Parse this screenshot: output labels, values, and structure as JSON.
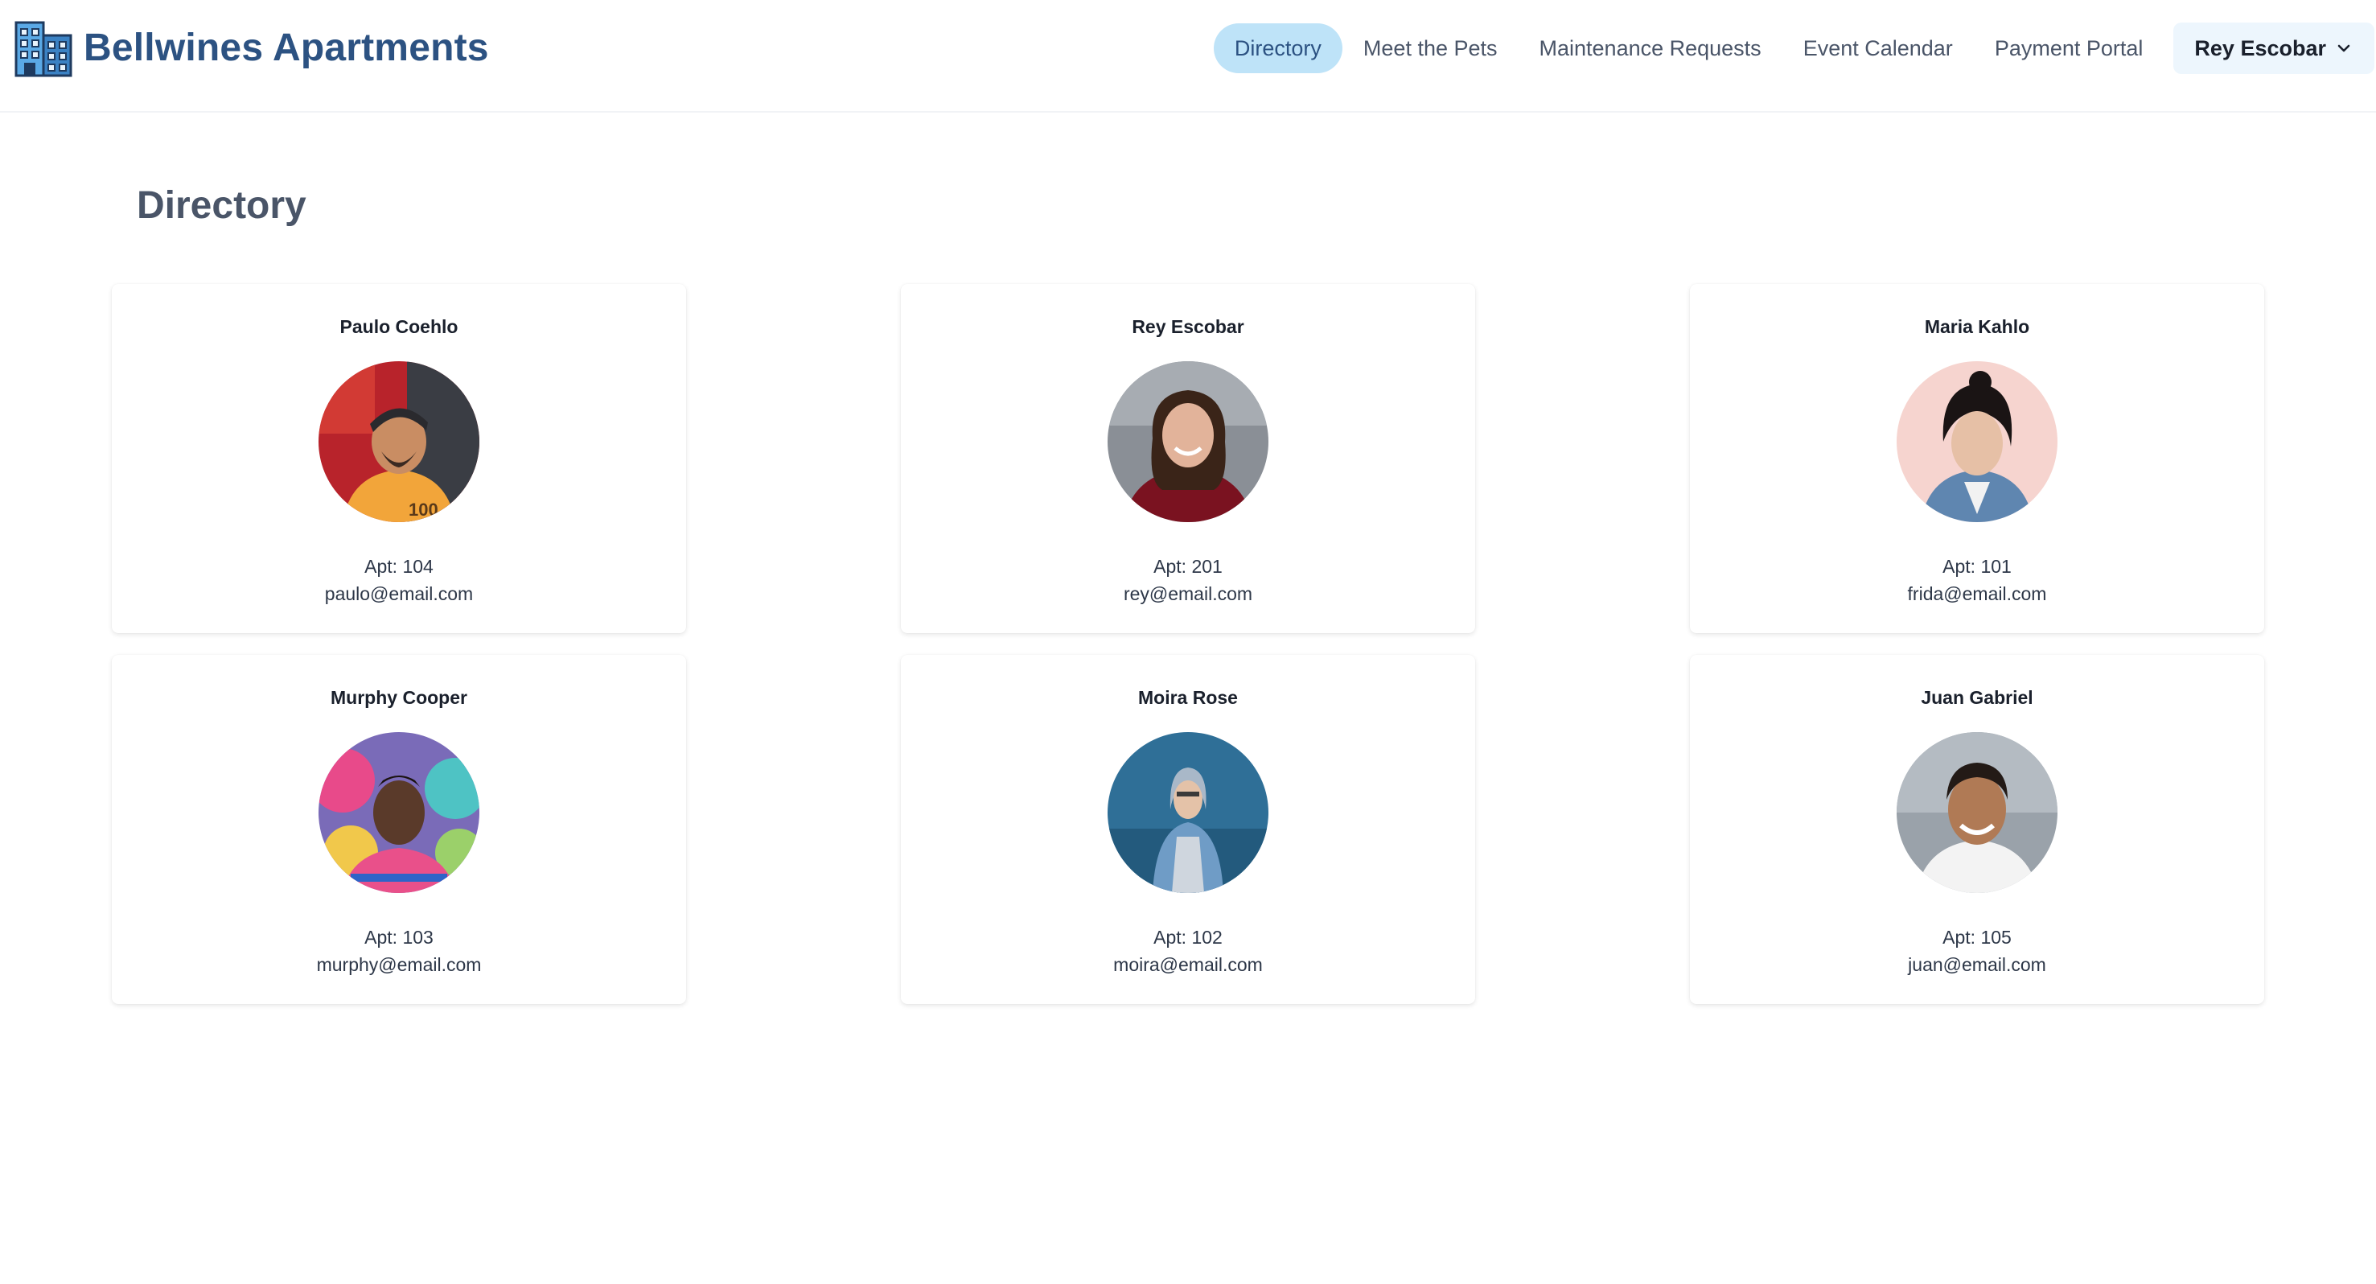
{
  "brand": {
    "name": "Bellwines Apartments",
    "icon": "building-icon",
    "color": "#2c5282"
  },
  "nav": {
    "items": [
      {
        "label": "Directory",
        "active": true
      },
      {
        "label": "Meet the Pets",
        "active": false
      },
      {
        "label": "Maintenance Requests",
        "active": false
      },
      {
        "label": "Event Calendar",
        "active": false
      },
      {
        "label": "Payment Portal",
        "active": false
      }
    ],
    "user": {
      "label": "Rey Escobar",
      "icon": "chevron-down-icon"
    }
  },
  "main": {
    "title": "Directory",
    "residents": [
      {
        "name": "Paulo Coehlo",
        "apt": "Apt: 104",
        "email": "paulo@email.com"
      },
      {
        "name": "Rey Escobar",
        "apt": "Apt: 201",
        "email": "rey@email.com"
      },
      {
        "name": "Maria Kahlo",
        "apt": "Apt: 101",
        "email": "frida@email.com"
      },
      {
        "name": "Murphy Cooper",
        "apt": "Apt: 103",
        "email": "murphy@email.com"
      },
      {
        "name": "Moira Rose",
        "apt": "Apt: 102",
        "email": "moira@email.com"
      },
      {
        "name": "Juan Gabriel",
        "apt": "Apt: 105",
        "email": "juan@email.com"
      }
    ]
  }
}
